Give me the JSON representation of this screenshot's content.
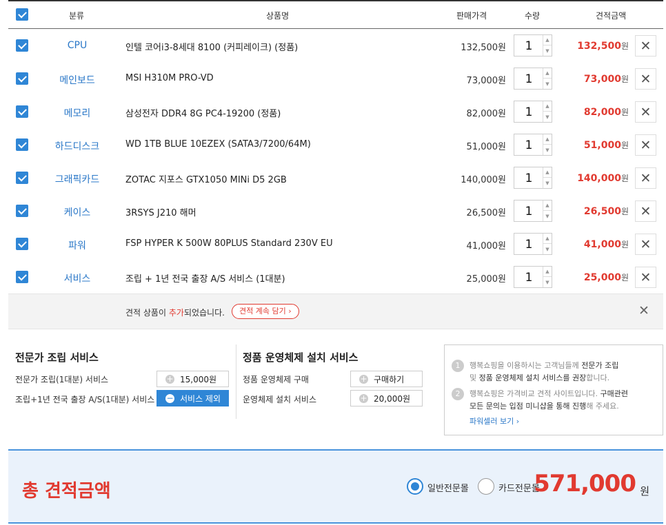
{
  "header": {
    "category": "분류",
    "product": "상품명",
    "price": "판매가격",
    "qty": "수량",
    "total": "견적금액"
  },
  "rows": [
    {
      "category": "CPU",
      "name": "인텔 코어i3-8세대 8100 (커피레이크) (정품)",
      "price": "132,500원",
      "qty": "1",
      "total": "132,500",
      "unit": "원"
    },
    {
      "category": "메인보드",
      "name": "MSI H310M PRO-VD",
      "price": "73,000원",
      "qty": "1",
      "total": "73,000",
      "unit": "원"
    },
    {
      "category": "메모리",
      "name": "삼성전자 DDR4 8G PC4-19200 (정품)",
      "price": "82,000원",
      "qty": "1",
      "total": "82,000",
      "unit": "원"
    },
    {
      "category": "하드디스크",
      "name": "WD 1TB BLUE 10EZEX (SATA3/7200/64M)",
      "price": "51,000원",
      "qty": "1",
      "total": "51,000",
      "unit": "원"
    },
    {
      "category": "그래픽카드",
      "name": "ZOTAC 지포스 GTX1050 MINi D5 2GB",
      "price": "140,000원",
      "qty": "1",
      "total": "140,000",
      "unit": "원"
    },
    {
      "category": "케이스",
      "name": "3RSYS J210 해머",
      "price": "26,500원",
      "qty": "1",
      "total": "26,500",
      "unit": "원"
    },
    {
      "category": "파워",
      "name": "FSP HYPER K 500W 80PLUS Standard 230V EU",
      "price": "41,000원",
      "qty": "1",
      "total": "41,000",
      "unit": "원"
    },
    {
      "category": "서비스",
      "name": "조립 + 1년 전국 출장 A/S 서비스 (1대분)",
      "price": "25,000원",
      "qty": "1",
      "total": "25,000",
      "unit": "원"
    }
  ],
  "notice": {
    "prefix": "견적 상품이 ",
    "highlight": "추가",
    "suffix": "되었습니다.",
    "button": "견적 계속 담기 ›"
  },
  "assembly": {
    "title": "전문가 조립 서비스",
    "row1_label": "전문가 조립(1대분) 서비스",
    "row1_button": "15,000원",
    "row2_label": "조립+1년 전국 출장 A/S(1대분) 서비스",
    "row2_button": "서비스 제외"
  },
  "os": {
    "title": "정품 운영체제 설치 서비스",
    "row1_label": "정품 운영체제 구매",
    "row1_button": "구매하기",
    "row2_label": "운영체제 설치 서비스",
    "row2_button": "20,000원"
  },
  "info": {
    "n1": "1",
    "l1a_pre": "행복쇼핑을 이용하시는 고객님들께 ",
    "l1a_bold": "전문가 조립",
    "l1b_pre": "및 ",
    "l1b_bold": "정품 운영체제 설치 서비스를 권장",
    "l1b_post": "합니다.",
    "n2": "2",
    "l2a_pre": "행복쇼핑은 가격비교 견적 사이트입니다. ",
    "l2a_bold": "구매관련",
    "l2b_bold": "모든 문의는 입점 미니샵을 통해 진행",
    "l2b_post": "해 주세요.",
    "link": "파워셀러 보기 ›"
  },
  "summary": {
    "title": "총 견적금액",
    "radio1": "일반전문몰",
    "radio2": "카드전문몰",
    "amount": "571,000",
    "unit": "원"
  },
  "colors": {
    "accent_blue": "#2f86d6",
    "accent_red": "#e13a30"
  }
}
